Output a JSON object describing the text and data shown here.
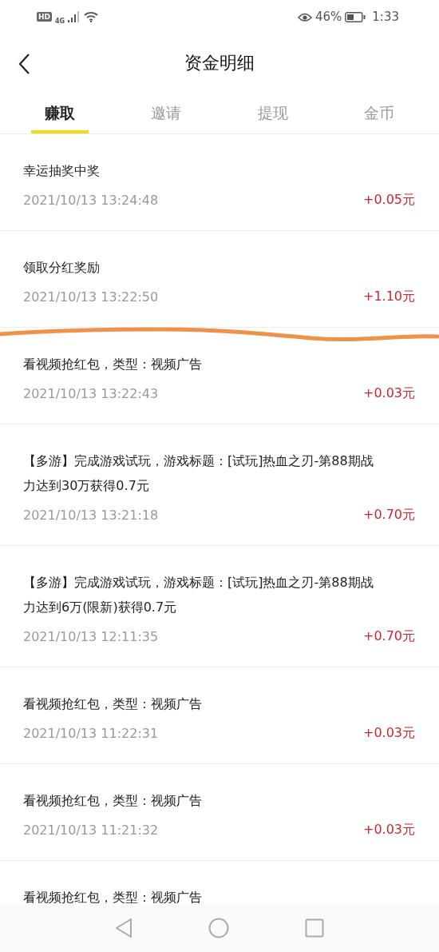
{
  "status_bar": {
    "hd": "HD",
    "network": "4G",
    "battery": "46%",
    "time": "1:33"
  },
  "header": {
    "title": "资金明细"
  },
  "tabs": [
    {
      "label": "赚取",
      "selected": true
    },
    {
      "label": "邀请",
      "selected": false
    },
    {
      "label": "提现",
      "selected": false
    },
    {
      "label": "金币",
      "selected": false
    }
  ],
  "records": [
    {
      "title": "幸运抽奖中奖",
      "time": "2021/10/13 13:24:48",
      "amount": "+0.05元"
    },
    {
      "title": "领取分红奖励",
      "time": "2021/10/13 13:22:50",
      "amount": "+1.10元"
    },
    {
      "title": "看视频抢红包，类型：视频广告",
      "time": "2021/10/13 13:22:43",
      "amount": "+0.03元"
    },
    {
      "title": "【多游】完成游戏试玩，游戏标题：[试玩]热血之刃-第88期战力达到30万获得0.7元",
      "time": "2021/10/13 13:21:18",
      "amount": "+0.70元"
    },
    {
      "title": "【多游】完成游戏试玩，游戏标题：[试玩]热血之刃-第88期战力达到6万(限新)获得0.7元",
      "time": "2021/10/13 12:11:35",
      "amount": "+0.70元"
    },
    {
      "title": "看视频抢红包，类型：视频广告",
      "time": "2021/10/13 11:22:31",
      "amount": "+0.03元"
    },
    {
      "title": "看视频抢红包，类型：视频广告",
      "time": "2021/10/13 11:21:32",
      "amount": "+0.03元"
    },
    {
      "title": "看视频抢红包，类型：视频广告"
    }
  ],
  "annotation": {
    "kind": "scribble",
    "color": "#f0914a"
  }
}
